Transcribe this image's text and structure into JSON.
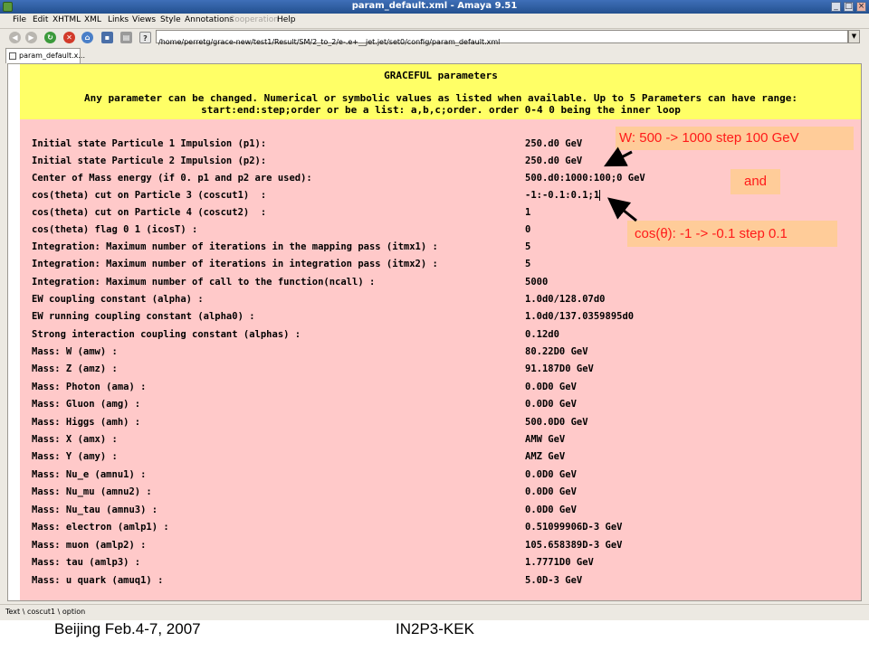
{
  "window": {
    "title": "param_default.xml - Amaya 9.51",
    "buttons": {
      "minimize": "_",
      "maximize": "□",
      "close": "×"
    }
  },
  "menu": {
    "items": [
      "File",
      "Edit",
      "XHTML",
      "XML",
      "Links",
      "Views",
      "Style",
      "Annotations",
      "Cooperation",
      "Help"
    ]
  },
  "toolbar": {
    "url": "/home/perretg/grace-new/test1/Result/SM/2_to_2/e-.e+__jet.jet/set0/config/param_default.xml"
  },
  "tab": {
    "label": "param_default.x..."
  },
  "document": {
    "title": "GRACEFUL parameters",
    "instructions": [
      "Any parameter can be changed. Numerical or symbolic values as listed when available. Up to 5 Parameters can have range:",
      "start:end:step;order or be a list: a,b,c;order. order 0-4 0 being the inner loop"
    ],
    "params": [
      {
        "label": "Initial state Particule 1 Impulsion (p1):",
        "value": "250.d0 GeV"
      },
      {
        "label": "Initial state Particule 2 Impulsion (p2):",
        "value": "250.d0 GeV"
      },
      {
        "label": "Center of Mass energy (if 0. p1 and p2 are used):",
        "value": "500.d0:1000:100;0 GeV"
      },
      {
        "label": "cos(theta) cut on Particle 3 (coscut1)  :",
        "value": "-1:-0.1:0.1;1"
      },
      {
        "label": "cos(theta) cut on Particle 4 (coscut2)  :",
        "value": "1"
      },
      {
        "label": "cos(theta) flag 0 1 (icosT) :",
        "value": "0"
      },
      {
        "label": "Integration: Maximum number of iterations in the mapping pass (itmx1) :",
        "value": "5"
      },
      {
        "label": "Integration: Maximum number of iterations in integration pass (itmx2) :",
        "value": "5"
      },
      {
        "label": "Integration: Maximum number of call to the function(ncall) :",
        "value": "5000"
      },
      {
        "label": "EW coupling constant (alpha) :",
        "value": "1.0d0/128.07d0"
      },
      {
        "label": "EW running coupling constant (alpha0) :",
        "value": "1.0d0/137.0359895d0"
      },
      {
        "label": "Strong interaction coupling constant (alphas) :",
        "value": "0.12d0"
      },
      {
        "label": "Mass: W (amw) :",
        "value": "80.22D0 GeV"
      },
      {
        "label": "Mass: Z (amz) :",
        "value": "91.187D0 GeV"
      },
      {
        "label": "Mass: Photon (ama) :",
        "value": "0.0D0 GeV"
      },
      {
        "label": "Mass: Gluon (amg) :",
        "value": "0.0D0 GeV"
      },
      {
        "label": "Mass: Higgs (amh) :",
        "value": "500.0D0 GeV"
      },
      {
        "label": "Mass: X (amx) :",
        "value": "AMW GeV"
      },
      {
        "label": "Mass: Y (amy) :",
        "value": "AMZ GeV"
      },
      {
        "label": "Mass: Nu_e (amnu1) :",
        "value": "0.0D0 GeV"
      },
      {
        "label": "Mass: Nu_mu (amnu2) :",
        "value": "0.0D0 GeV"
      },
      {
        "label": "Mass: Nu_tau (amnu3) :",
        "value": "0.0D0 GeV"
      },
      {
        "label": "Mass: electron (amlp1) :",
        "value": "0.51099906D-3 GeV"
      },
      {
        "label": "Mass: muon (amlp2) :",
        "value": "105.658389D-3 GeV"
      },
      {
        "label": "Mass: tau (amlp3) :",
        "value": "1.7771D0 GeV"
      },
      {
        "label": "Mass: u quark (amuq1) :",
        "value": "5.0D-3 GeV"
      }
    ]
  },
  "status": {
    "path": "Text \\ coscut1 \\ option"
  },
  "footer": {
    "left": "Beijing Feb.4-7, 2007",
    "center": "IN2P3-KEK"
  },
  "annotations": {
    "w_range": "W: 500 -> 1000 step 100 GeV",
    "and": "and",
    "cos_range": "cos(θ): -1 -> -0.1 step 0.1"
  },
  "colors": {
    "banner": "#ffff66",
    "params_bg": "#ffc9c9",
    "annotation_bg": "#ffcc99",
    "annotation_text": "#ff1a1a"
  }
}
